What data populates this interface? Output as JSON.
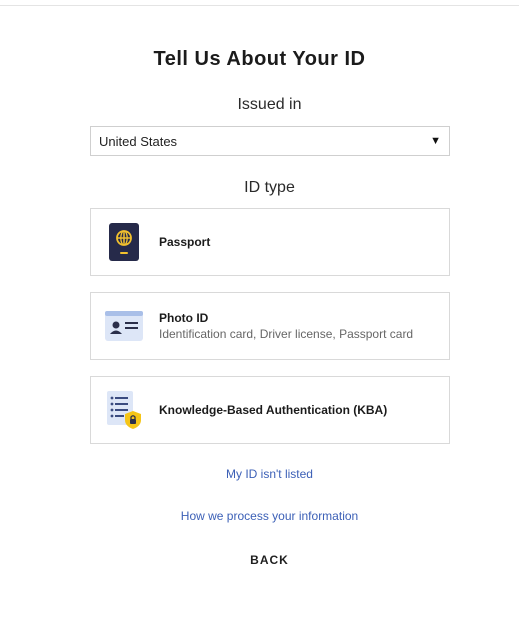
{
  "page": {
    "title": "Tell Us About Your ID"
  },
  "issued_in": {
    "label": "Issued in",
    "selected_country": "United States"
  },
  "id_type": {
    "label": "ID type",
    "options": [
      {
        "title": "Passport",
        "subtitle": "",
        "icon": "passport-icon"
      },
      {
        "title": "Photo ID",
        "subtitle": "Identification card, Driver license, Passport card",
        "icon": "photo-id-card-icon"
      },
      {
        "title": "Knowledge-Based Authentication (KBA)",
        "subtitle": "",
        "icon": "kba-document-lock-icon"
      }
    ]
  },
  "links": {
    "not_listed": "My ID isn't listed",
    "process_info": "How we process your information"
  },
  "actions": {
    "back": "BACK"
  },
  "colors": {
    "link": "#3b5fb6",
    "passport_cover": "#262a4a",
    "passport_emblem": "#f2c12e",
    "card_blue": "#dde6f7",
    "lock_yellow": "#f5c518"
  }
}
